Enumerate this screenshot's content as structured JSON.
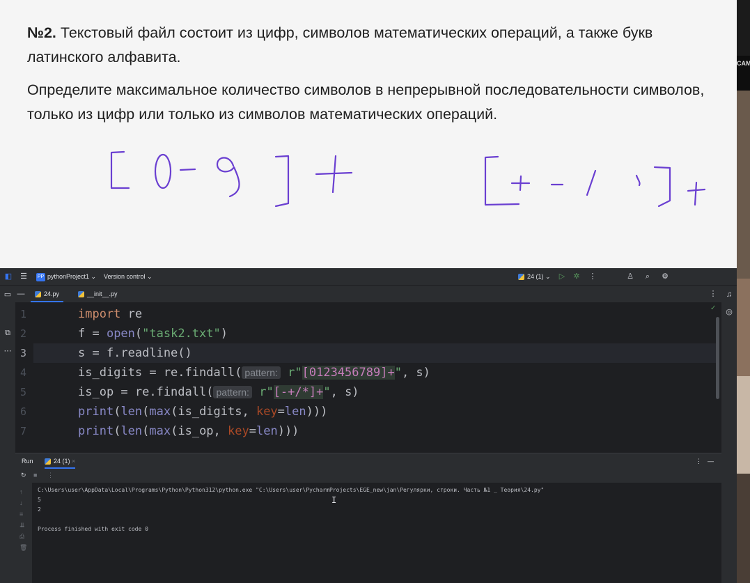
{
  "slide": {
    "task_number": "№2.",
    "task_text": "Текстовый файл состоит из цифр, символов математических операций, а также букв латинского алфавита.",
    "question": "Определите максимальное количество символов в непрерывной последовательности символов, только из цифр или только из символов математических операций."
  },
  "camera": {
    "label": "CAM"
  },
  "ide": {
    "project": "pythonProject1",
    "project_badge": "PP",
    "vcs": "Version control",
    "run_config": "24 (1)",
    "tabs": [
      {
        "label": "24.py",
        "active": true
      },
      {
        "label": "__init__.py",
        "active": false
      }
    ],
    "line_numbers": [
      "1",
      "2",
      "3",
      "4",
      "5",
      "6",
      "7"
    ],
    "code": {
      "l1_kw": "import",
      "l1_rest": " re",
      "l2_a": "f = ",
      "l2_fn": "open",
      "l2_b": "(",
      "l2_str": "\"task2.txt\"",
      "l2_c": ")",
      "l3": "s = f.readline()",
      "l4_a": "is_digits = re.findall(",
      "l4_hint": "pattern:",
      "l4_pre": "r\"",
      "l4_rx": "[0123456789]+",
      "l4_post": "\"",
      "l4_end": ", s)",
      "l5_a": "is_op = re.findall(",
      "l5_hint": "pattern:",
      "l5_pre": "r\"",
      "l5_rx": "[-+/*]+",
      "l5_post": "\"",
      "l5_end": ", s)",
      "l6_print": "print",
      "l6_a": "(",
      "l6_len": "len",
      "l6_b": "(",
      "l6_max": "max",
      "l6_c": "(is_digits, ",
      "l6_key": "key",
      "l6_eq": "=",
      "l6_len2": "len",
      "l6_end": ")))",
      "l7_print": "print",
      "l7_a": "(",
      "l7_len": "len",
      "l7_b": "(",
      "l7_max": "max",
      "l7_c": "(is_op, ",
      "l7_key": "key",
      "l7_eq": "=",
      "l7_len2": "len",
      "l7_end": ")))"
    },
    "run": {
      "title": "Run",
      "tab": "24 (1)",
      "command": "C:\\Users\\user\\AppData\\Local\\Programs\\Python\\Python312\\python.exe \"C:\\Users\\user\\PycharmProjects\\EGE_new\\jan\\Регулярки, строки. Часть №1 _ Теория\\24.py\"",
      "out1": "5",
      "out2": "2",
      "finished": "Process finished with exit code 0"
    },
    "accent": "#3574f0"
  }
}
